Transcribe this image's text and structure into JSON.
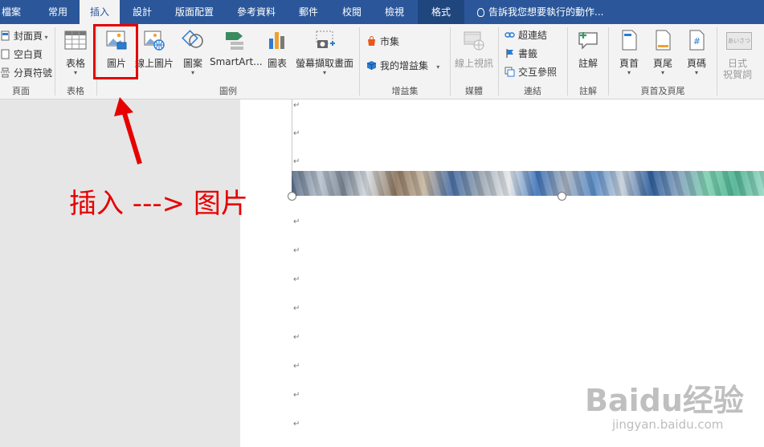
{
  "tabs": [
    {
      "label": "檔案"
    },
    {
      "label": "常用"
    },
    {
      "label": "插入"
    },
    {
      "label": "設計"
    },
    {
      "label": "版面配置"
    },
    {
      "label": "參考資料"
    },
    {
      "label": "郵件"
    },
    {
      "label": "校閱"
    },
    {
      "label": "檢視"
    },
    {
      "label": "格式"
    }
  ],
  "tell_me": "告訴我您想要執行的動作...",
  "ribbon": {
    "pages": {
      "cover": "封面頁",
      "blank": "空白頁",
      "page_break": "分頁符號",
      "group": "頁面"
    },
    "tables": {
      "table": "表格",
      "group": "表格"
    },
    "illustrations": {
      "pictures": "圖片",
      "online_pictures": "線上圖片",
      "shapes": "圖案",
      "smartart": "SmartArt...",
      "chart": "圖表",
      "screenshot": "螢幕擷取畫面",
      "group": "圖例"
    },
    "addins": {
      "store": "市集",
      "my_addins": "我的增益集",
      "group": "增益集"
    },
    "media": {
      "online_video": "線上視訊",
      "group": "媒體"
    },
    "links": {
      "hyperlink": "超連結",
      "bookmark": "書籤",
      "cross_ref": "交互參照",
      "group": "連結"
    },
    "comments": {
      "comment": "註解",
      "group": "註解"
    },
    "header_footer": {
      "header": "頁首",
      "footer": "頁尾",
      "page_number": "頁碼",
      "group": "頁首及頁尾"
    },
    "japanese": {
      "greeting_l1": "日式",
      "greeting_l2": "祝賀詞",
      "icon_text": "あいさつ"
    }
  },
  "annotation": {
    "caption": "插入 ---> 图片",
    "accent": "#e60000"
  },
  "document": {
    "paragraph_mark": "↵"
  },
  "watermark": {
    "logo": "Baidu经验",
    "url": "jingyan.baidu.com"
  },
  "colors": {
    "tab_bar": "#2b579a",
    "ribbon": "#f3f3f3",
    "left_pane": "#e6e6e6"
  }
}
